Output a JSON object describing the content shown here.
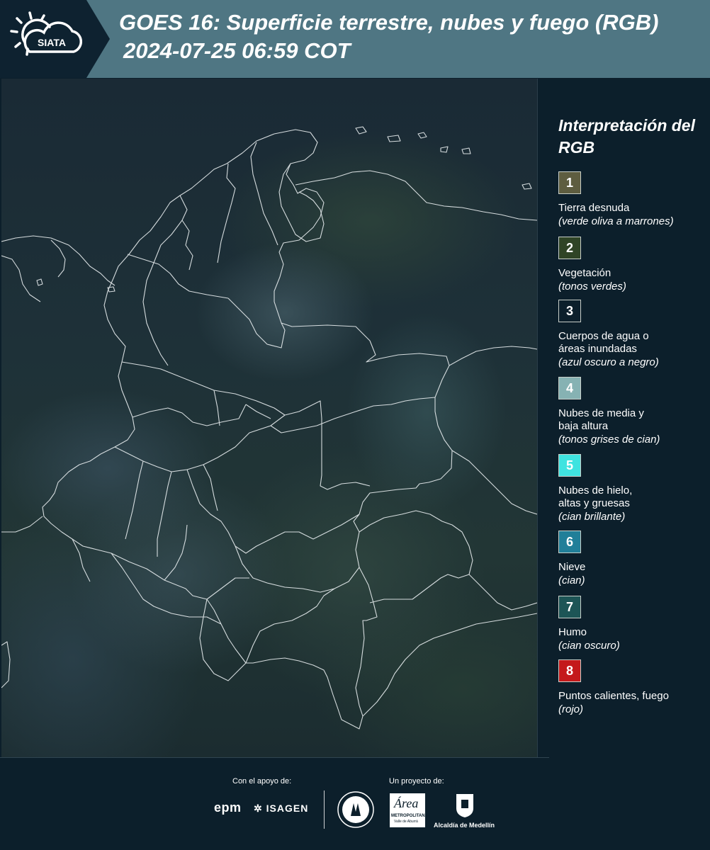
{
  "header": {
    "logo_text": "SIATA",
    "title_line1": "GOES 16: Superficie terrestre, nubes y fuego (RGB)",
    "title_line2": "2024-07-25 06:59 COT"
  },
  "map": {
    "icon": "map-image"
  },
  "legend": {
    "title": "Interpretación del RGB",
    "items": [
      {
        "number": "1",
        "label": "Tierra desnuda",
        "description": "(verde oliva a marrones)",
        "color": "#5e5d40"
      },
      {
        "number": "2",
        "label": "Vegetación",
        "description": "(tonos verdes)",
        "color": "#2f4426"
      },
      {
        "number": "3",
        "label": "Cuerpos de agua o\náreas inundadas",
        "description": "(azul oscuro a negro)",
        "color": "#0c1f2b"
      },
      {
        "number": "4",
        "label": "Nubes de media y\nbaja altura",
        "description": "(tonos grises de cian)",
        "color": "#86b2b3"
      },
      {
        "number": "5",
        "label": "Nubes de hielo,\naltas y gruesas",
        "description": "(cian brillante)",
        "color": "#3fe3e0"
      },
      {
        "number": "6",
        "label": "Nieve",
        "description": "(cian)",
        "color": "#217f99"
      },
      {
        "number": "7",
        "label": "Humo",
        "description": "(cian oscuro)",
        "color": "#1d5556"
      },
      {
        "number": "8",
        "label": "Puntos calientes, fuego",
        "description": "(rojo)",
        "color": "#c4191b"
      }
    ]
  },
  "footer": {
    "support_label": "Con el apoyo de:",
    "project_label": "Un proyecto de:",
    "sponsors": [
      "epm",
      "ISAGEN"
    ],
    "partners": {
      "metropolitana": "METROPOLITANA",
      "metropolitana_sub": "Valle de Aburrá",
      "alcaldia": "Alcaldía de Medellín"
    }
  }
}
